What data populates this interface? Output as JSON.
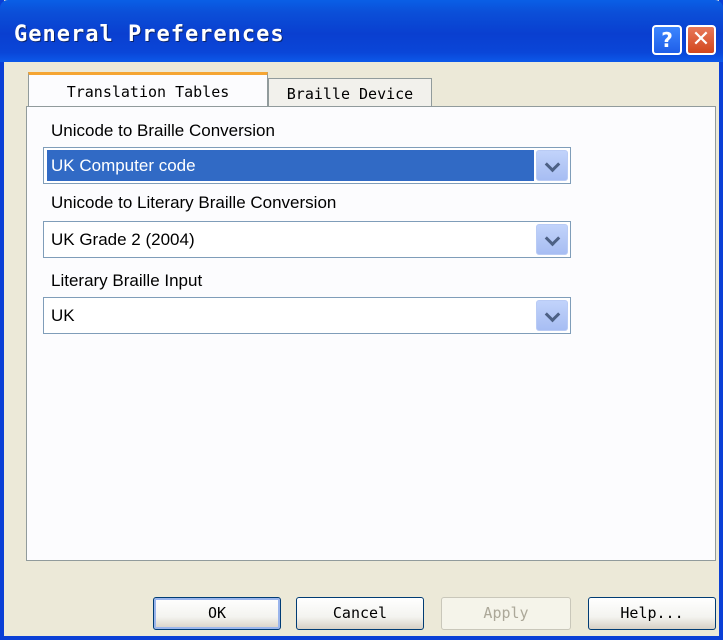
{
  "window": {
    "title": "General Preferences",
    "help_glyph": "?",
    "close_glyph": "✕"
  },
  "tabs": [
    {
      "label": "Translation Tables",
      "selected": true
    },
    {
      "label": "Braille Device",
      "selected": false
    }
  ],
  "fields": {
    "unicode_to_braille": {
      "label": "Unicode to Braille Conversion",
      "value": "UK Computer code",
      "highlighted": true
    },
    "unicode_to_literary": {
      "label": "Unicode to Literary Braille Conversion",
      "value": "UK Grade 2 (2004)"
    },
    "literary_input": {
      "label": "Literary Braille Input",
      "value": "UK"
    }
  },
  "buttons": {
    "ok": "OK",
    "cancel": "Cancel",
    "apply": "Apply",
    "help": "Help..."
  },
  "colors": {
    "title_bar": "#0a3fd0",
    "selection": "#316ac5",
    "active_tab_accent": "#f5a533",
    "dialog_bg": "#ece9d8"
  },
  "icons": {
    "help": "question-mark-icon",
    "close": "close-icon",
    "dropdown": "chevron-down-icon"
  }
}
